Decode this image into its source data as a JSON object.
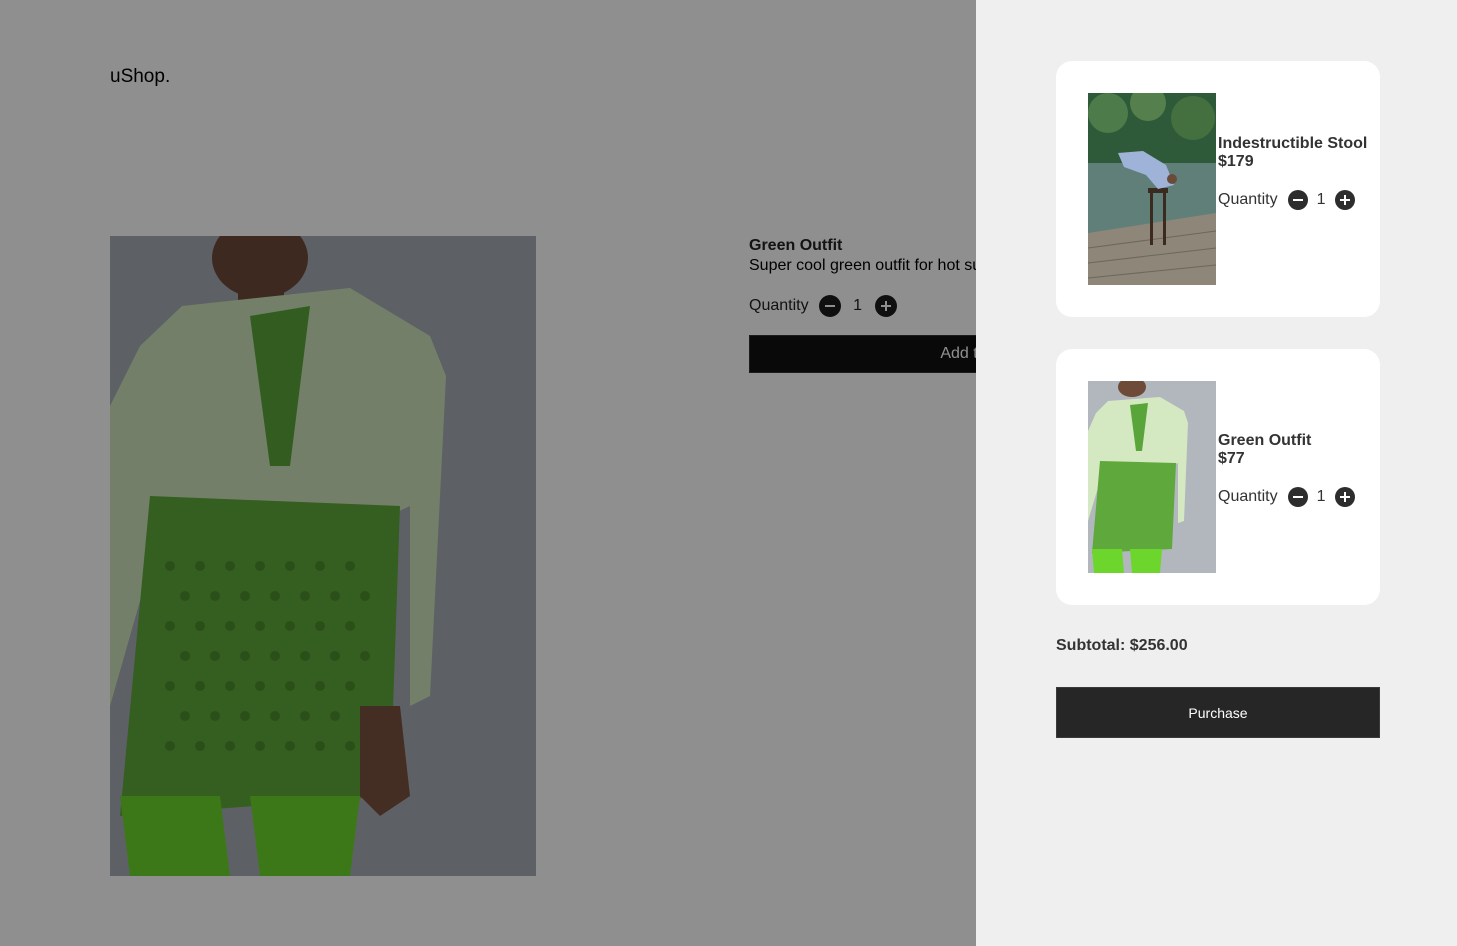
{
  "brand": {
    "logo": "uShop."
  },
  "product": {
    "title": "Green Outfit",
    "description": "Super cool green outfit for hot summer days",
    "quantity_label": "Quantity",
    "quantity": "1",
    "add_to_cart_label": "Add to cart",
    "image_icon": "green-outfit-photo"
  },
  "cart": {
    "items": [
      {
        "name": "Indestructible Stool",
        "price": "$179",
        "quantity_label": "Quantity",
        "quantity": "1",
        "image_icon": "stool-photo"
      },
      {
        "name": "Green Outfit",
        "price": "$77",
        "quantity_label": "Quantity",
        "quantity": "1",
        "image_icon": "green-outfit-photo"
      }
    ],
    "subtotal": "Subtotal: $256.00",
    "purchase_label": "Purchase"
  },
  "icons": {
    "decrease": "minus-icon",
    "increase": "plus-icon"
  },
  "colors": {
    "overlay": "#000000",
    "drawer_bg": "#efefef",
    "button_bg": "#262626",
    "card_bg": "#ffffff"
  }
}
